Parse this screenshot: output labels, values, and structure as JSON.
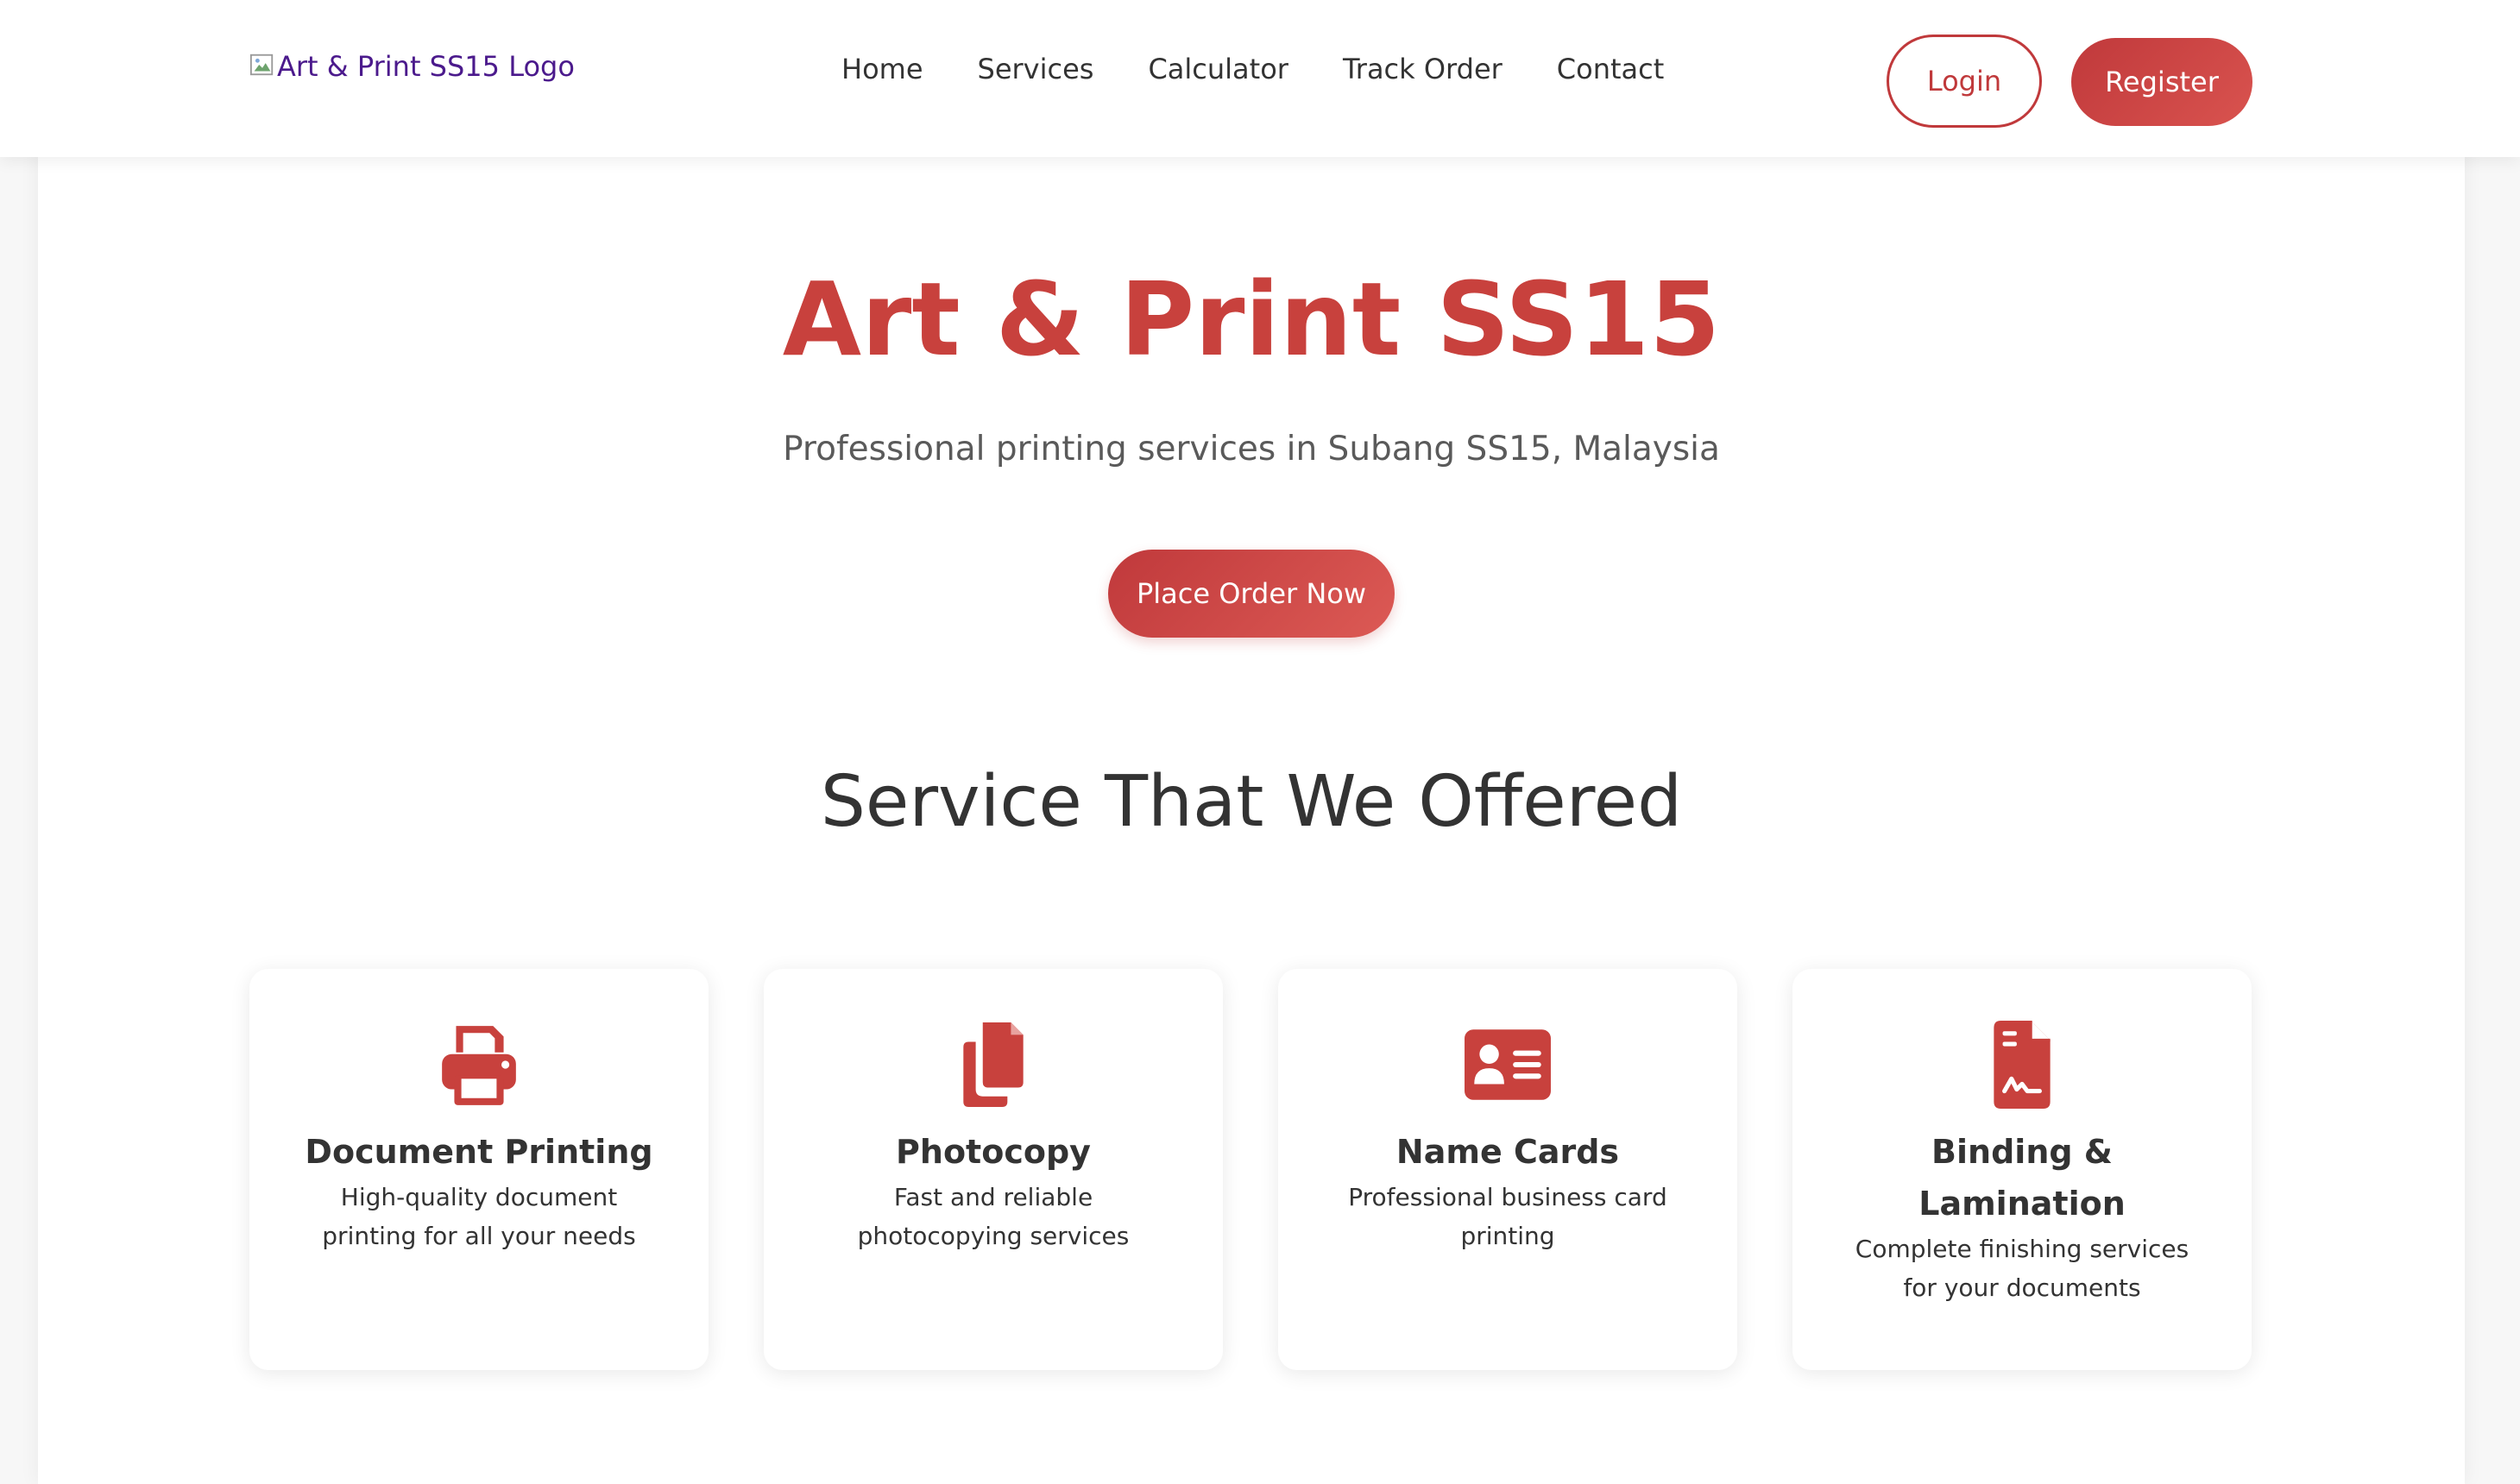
{
  "brand": {
    "logo_alt": "Art & Print SS15 Logo",
    "accent_color": "#c8413d"
  },
  "nav": {
    "items": [
      {
        "label": "Home"
      },
      {
        "label": "Services"
      },
      {
        "label": "Calculator"
      },
      {
        "label": "Track Order"
      },
      {
        "label": "Contact"
      }
    ],
    "login_label": "Login",
    "register_label": "Register"
  },
  "hero": {
    "title": "Art & Print SS15",
    "subtitle": "Professional printing services in Subang SS15, Malaysia",
    "cta_label": "Place Order Now"
  },
  "services": {
    "heading": "Service That We Offered",
    "items": [
      {
        "icon": "printer-icon",
        "title": "Document Printing",
        "description": "High-quality document printing for all your needs"
      },
      {
        "icon": "copy-icon",
        "title": "Photocopy",
        "description": "Fast and reliable photocopying services"
      },
      {
        "icon": "id-card-icon",
        "title": "Name Cards",
        "description": "Professional business card printing"
      },
      {
        "icon": "file-signature-icon",
        "title": "Binding & Lamination",
        "description": "Complete finishing services for your documents"
      }
    ]
  }
}
